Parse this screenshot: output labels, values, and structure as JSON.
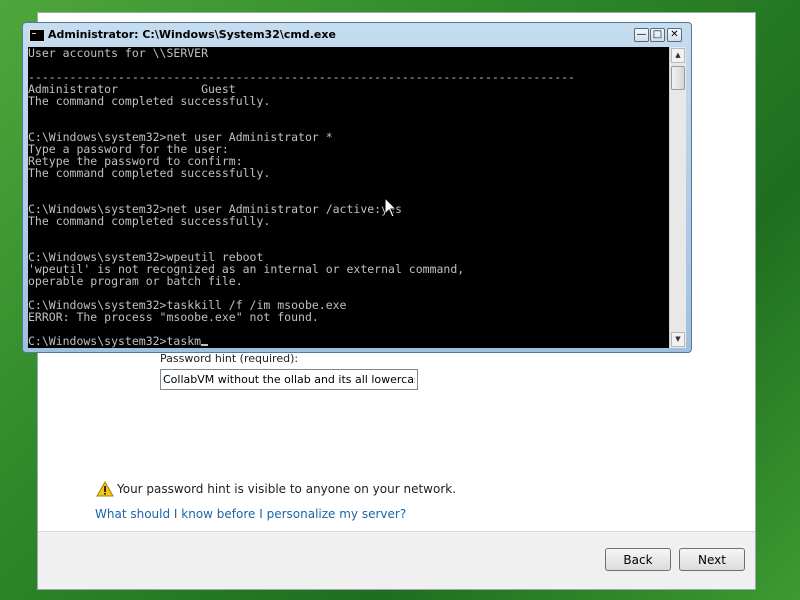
{
  "oobe": {
    "password_hint_label": "Password hint (required):",
    "password_hint_value": "CollabVM without the ollab and its all lowercase",
    "warning_text": "Your password hint is visible to anyone on your network.",
    "help_link": "What should I know before I personalize my server?",
    "back_label": "Back",
    "next_label": "Next"
  },
  "cmd": {
    "title": "Administrator: C:\\Windows\\System32\\cmd.exe",
    "lines": [
      "User accounts for \\\\SERVER",
      "",
      "-------------------------------------------------------------------------------",
      "Administrator            Guest",
      "The command completed successfully.",
      "",
      "",
      "C:\\Windows\\system32>net user Administrator *",
      "Type a password for the user:",
      "Retype the password to confirm:",
      "The command completed successfully.",
      "",
      "",
      "C:\\Windows\\system32>net user Administrator /active:yes",
      "The command completed successfully.",
      "",
      "",
      "C:\\Windows\\system32>wpeutil reboot",
      "'wpeutil' is not recognized as an internal or external command,",
      "operable program or batch file.",
      "",
      "C:\\Windows\\system32>taskkill /f /im msoobe.exe",
      "ERROR: The process \"msoobe.exe\" not found.",
      "",
      "C:\\Windows\\system32>taskm"
    ],
    "minimize_icon": "minimize-icon",
    "maximize_icon": "maximize-icon",
    "close_icon": "close-icon",
    "text_color": "#c0c0c0",
    "background_color": "#000000"
  },
  "colors": {
    "desktop_green": "#2f8a2a",
    "link_blue": "#1f63a8"
  }
}
